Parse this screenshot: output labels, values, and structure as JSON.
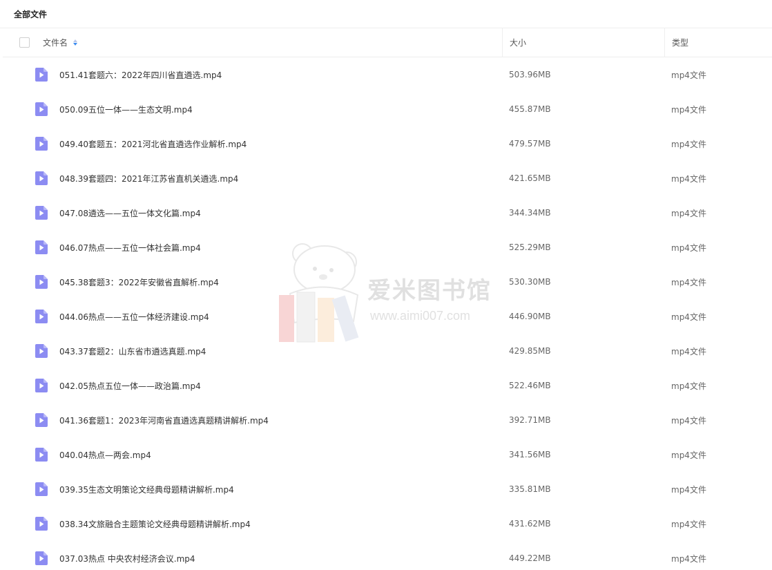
{
  "header": {
    "title": "全部文件"
  },
  "columns": {
    "name": "文件名",
    "size": "大小",
    "type": "类型"
  },
  "colors": {
    "file_icon": "#8c8cf2",
    "sort_active": "#3b8cf0"
  },
  "files": [
    {
      "name": "051.41套题六：2022年四川省直遴选.mp4",
      "size": "503.96MB",
      "type": "mp4文件"
    },
    {
      "name": "050.09五位一体——生态文明.mp4",
      "size": "455.87MB",
      "type": "mp4文件"
    },
    {
      "name": "049.40套题五：2021河北省直遴选作业解析.mp4",
      "size": "479.57MB",
      "type": "mp4文件"
    },
    {
      "name": "048.39套题四：2021年江苏省直机关遴选.mp4",
      "size": "421.65MB",
      "type": "mp4文件"
    },
    {
      "name": "047.08遴选——五位一体文化篇.mp4",
      "size": "344.34MB",
      "type": "mp4文件"
    },
    {
      "name": "046.07热点——五位一体社会篇.mp4",
      "size": "525.29MB",
      "type": "mp4文件"
    },
    {
      "name": "045.38套题3：2022年安徽省直解析.mp4",
      "size": "530.30MB",
      "type": "mp4文件"
    },
    {
      "name": "044.06热点——五位一体经济建设.mp4",
      "size": "446.90MB",
      "type": "mp4文件"
    },
    {
      "name": "043.37套题2：山东省市遴选真题.mp4",
      "size": "429.85MB",
      "type": "mp4文件"
    },
    {
      "name": "042.05热点五位一体——政治篇.mp4",
      "size": "522.46MB",
      "type": "mp4文件"
    },
    {
      "name": "041.36套题1：2023年河南省直遴选真题精讲解析.mp4",
      "size": "392.71MB",
      "type": "mp4文件"
    },
    {
      "name": "040.04热点—两会.mp4",
      "size": "341.56MB",
      "type": "mp4文件"
    },
    {
      "name": "039.35生态文明策论文经典母题精讲解析.mp4",
      "size": "335.81MB",
      "type": "mp4文件"
    },
    {
      "name": "038.34文旅融合主题策论文经典母题精讲解析.mp4",
      "size": "431.62MB",
      "type": "mp4文件"
    },
    {
      "name": "037.03热点 中央农村经济会议.mp4",
      "size": "449.22MB",
      "type": "mp4文件"
    }
  ],
  "watermark": {
    "title": "爱米图书馆",
    "url": "www.aimi007.com"
  }
}
